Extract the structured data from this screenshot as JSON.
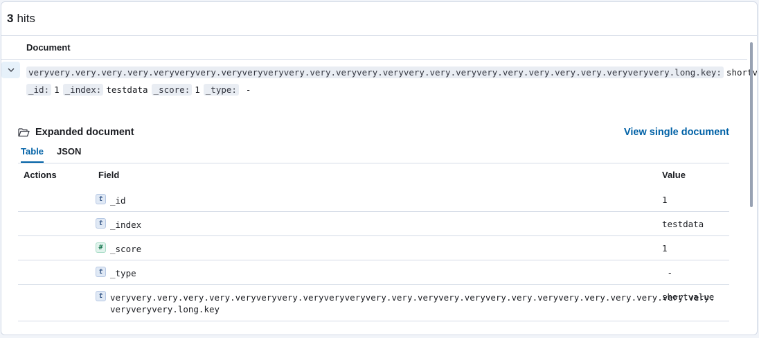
{
  "hits": {
    "count": "3",
    "label": "hits"
  },
  "document_column": "Document",
  "summary": {
    "line1": [
      {
        "key": "veryvery.very.very.very.veryveryvery.veryveryveryvery.very.veryvery.veryvery.very.veryvery.very.very.very.very.veryveryvery.long.key:",
        "value": "shortvalue"
      }
    ],
    "line2": [
      {
        "key": "_id:",
        "value": "1"
      },
      {
        "key": "_index:",
        "value": "testdata"
      },
      {
        "key": "_score:",
        "value": "1"
      },
      {
        "key": "_type:",
        "value": "-"
      }
    ]
  },
  "expanded": {
    "title": "Expanded document",
    "view_single": "View single document",
    "tabs": [
      {
        "label": "Table",
        "active": true
      },
      {
        "label": "JSON",
        "active": false
      }
    ]
  },
  "table": {
    "headers": {
      "actions": "Actions",
      "field": "Field",
      "value": "Value"
    },
    "rows": [
      {
        "type": "t",
        "field": "_id",
        "value": "1"
      },
      {
        "type": "t",
        "field": "_index",
        "value": "testdata"
      },
      {
        "type": "#",
        "field": "_score",
        "value": "1"
      },
      {
        "type": "t",
        "field": "_type",
        "value": " -"
      },
      {
        "type": "t",
        "field_line1": "veryvery.very.very.very.veryveryvery.veryveryveryvery.very.veryvery.veryvery.very.veryvery.very.very.very.very.very.",
        "field_line2": "veryveryvery.long.key",
        "value": "shortvalue"
      }
    ]
  },
  "colors": {
    "accent": "#0061a6",
    "border": "#d3dae6"
  }
}
